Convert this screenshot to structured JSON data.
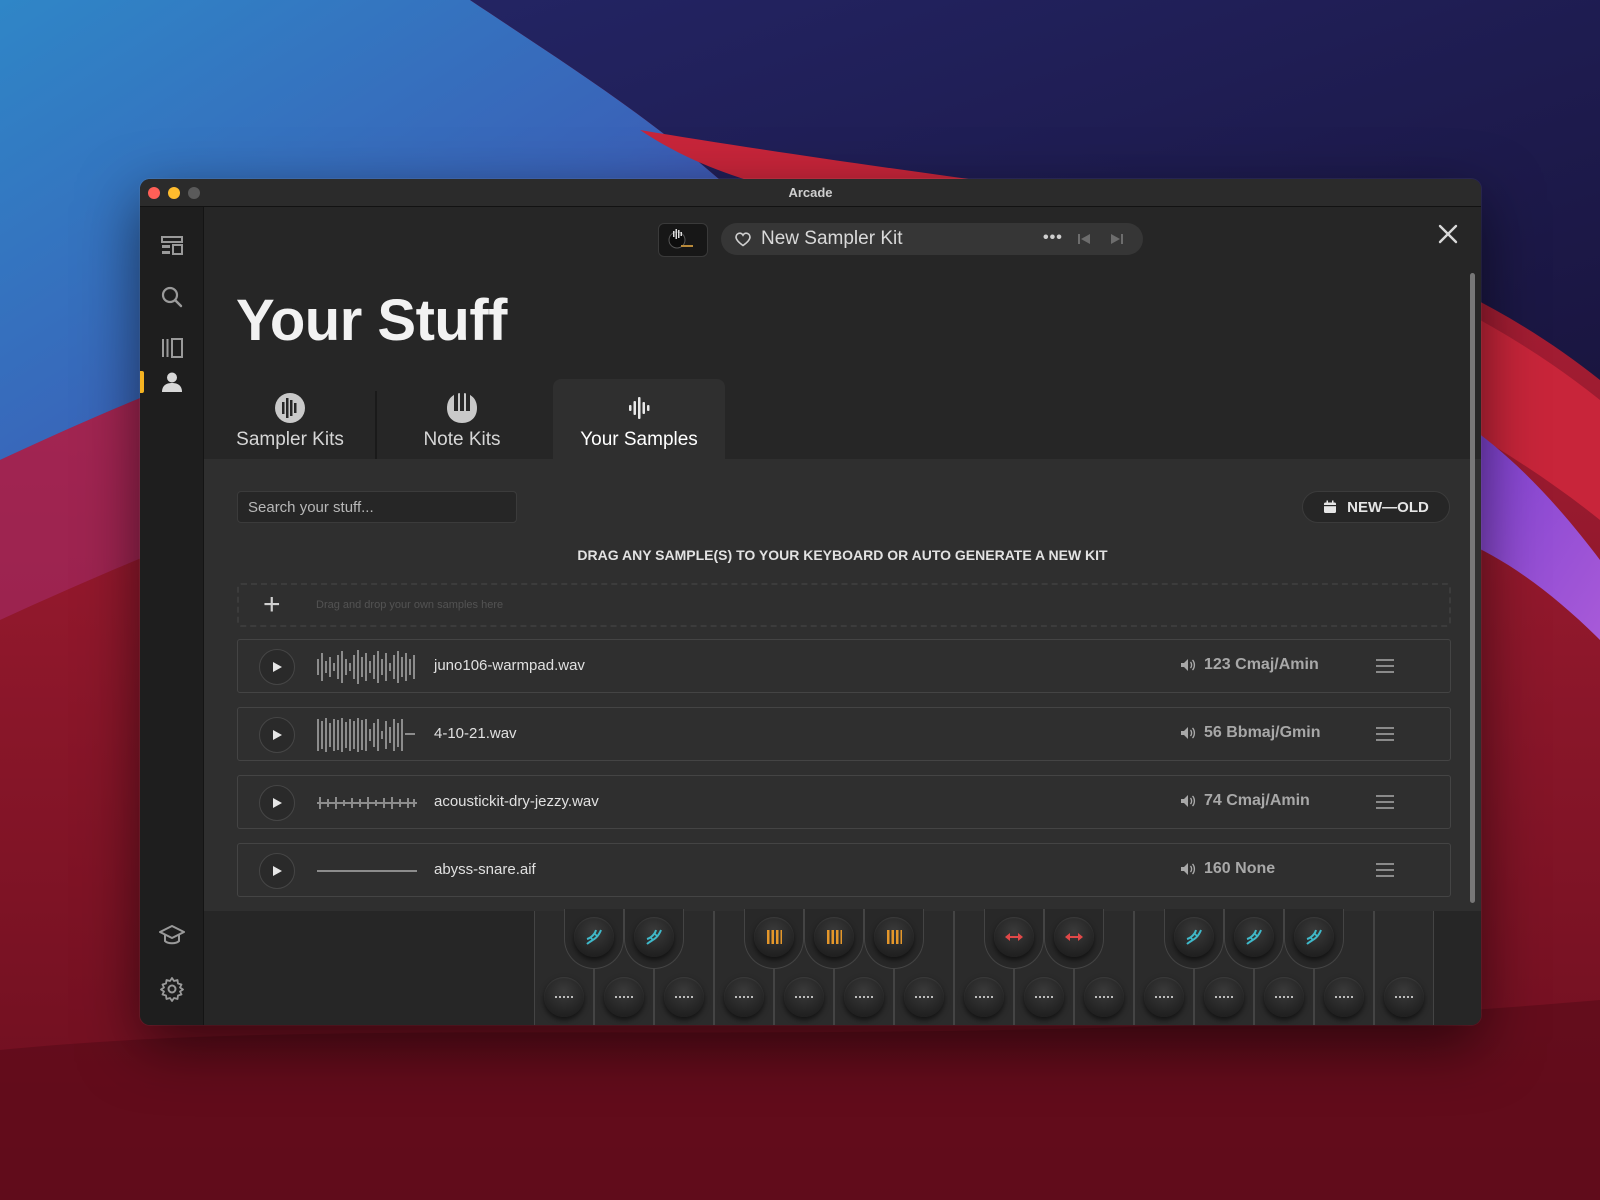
{
  "window": {
    "title": "Arcade"
  },
  "sidebar": {
    "items": [
      {
        "icon": "dashboard-icon"
      },
      {
        "icon": "search-icon"
      },
      {
        "icon": "library-icon"
      },
      {
        "icon": "user-icon",
        "active": true
      },
      {
        "icon": "graduation-cap-icon"
      },
      {
        "icon": "gear-icon"
      }
    ],
    "accent": "#f5b321"
  },
  "player": {
    "kit_name": "New Sampler Kit",
    "more_label": "•••"
  },
  "page": {
    "title": "Your Stuff"
  },
  "tabs": [
    {
      "label": "Sampler Kits",
      "icon": "sampler-kits-icon"
    },
    {
      "label": "Note Kits",
      "icon": "note-kits-icon"
    },
    {
      "label": "Your Samples",
      "icon": "waveform-icon",
      "active": true
    }
  ],
  "search": {
    "placeholder": "Search your stuff..."
  },
  "sort": {
    "label": "NEW—OLD",
    "icon": "calendar-icon"
  },
  "instructions": "DRAG ANY SAMPLE(S) TO YOUR KEYBOARD OR AUTO GENERATE A NEW KIT",
  "dropzone": {
    "text": "Drag and drop your own samples here",
    "icon": "plus-icon"
  },
  "samples": [
    {
      "filename": "juno106-warmpad.wav",
      "meta": "123 Cmaj/Amin"
    },
    {
      "filename": "4-10-21.wav",
      "meta": "56 Bbmaj/Gmin"
    },
    {
      "filename": "acoustickit-dry-jezzy.wav",
      "meta": "74 Cmaj/Amin"
    },
    {
      "filename": "abyss-snare.aif",
      "meta": "160 None"
    }
  ],
  "keyboard": {
    "black_key_icons": [
      "dna-icon",
      "dna-icon",
      "bars-icon",
      "bars-icon",
      "bars-icon",
      "arrows-icon",
      "arrows-icon",
      "dna-icon",
      "dna-icon",
      "dna-icon"
    ],
    "colors": {
      "dna": "#3fb8c9",
      "bars": "#e5972a",
      "arrows": "#e04848"
    }
  }
}
